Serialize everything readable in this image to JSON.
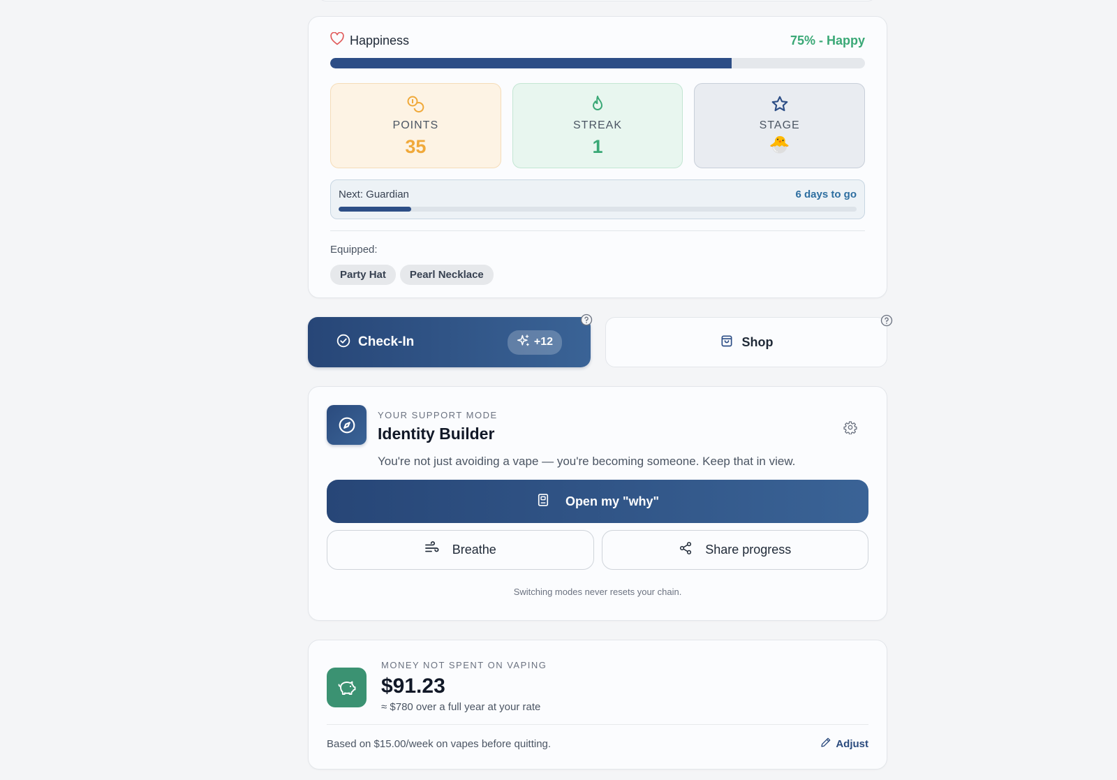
{
  "happiness": {
    "label": "Happiness",
    "status": "75% - Happy",
    "level": 0.75
  },
  "stats": {
    "points": {
      "label": "POINTS",
      "value": "35"
    },
    "streak": {
      "label": "STREAK",
      "value": "1"
    },
    "stage": {
      "label": "STAGE",
      "emoji": "🐣"
    }
  },
  "next_stage": {
    "label": "Next: Guardian",
    "days": "6 days to go",
    "progress": 0.14
  },
  "equipped": {
    "label": "Equipped:",
    "items": [
      "Party Hat",
      "Pearl Necklace"
    ]
  },
  "actions": {
    "checkin_label": "Check-In",
    "checkin_bonus": "+12",
    "shop_label": "Shop"
  },
  "support": {
    "kicker": "YOUR SUPPORT MODE",
    "title": "Identity Builder",
    "description": "You're not just avoiding a vape — you're becoming someone. Keep that in view.",
    "why_label": "Open my \"why\"",
    "breathe_label": "Breathe",
    "share_label": "Share progress",
    "footnote": "Switching modes never resets your chain."
  },
  "money": {
    "kicker": "MONEY NOT SPENT ON VAPING",
    "amount": "$91.23",
    "yearly": "≈ $780 over a full year at your rate",
    "basis": "Based on $15.00/week on vapes before quitting.",
    "adjust_label": "Adjust"
  },
  "colors": {
    "primary": "#2d4e86",
    "happy_green": "#3aa876",
    "points_orange": "#f0a93a",
    "money_green": "#3b9272"
  }
}
